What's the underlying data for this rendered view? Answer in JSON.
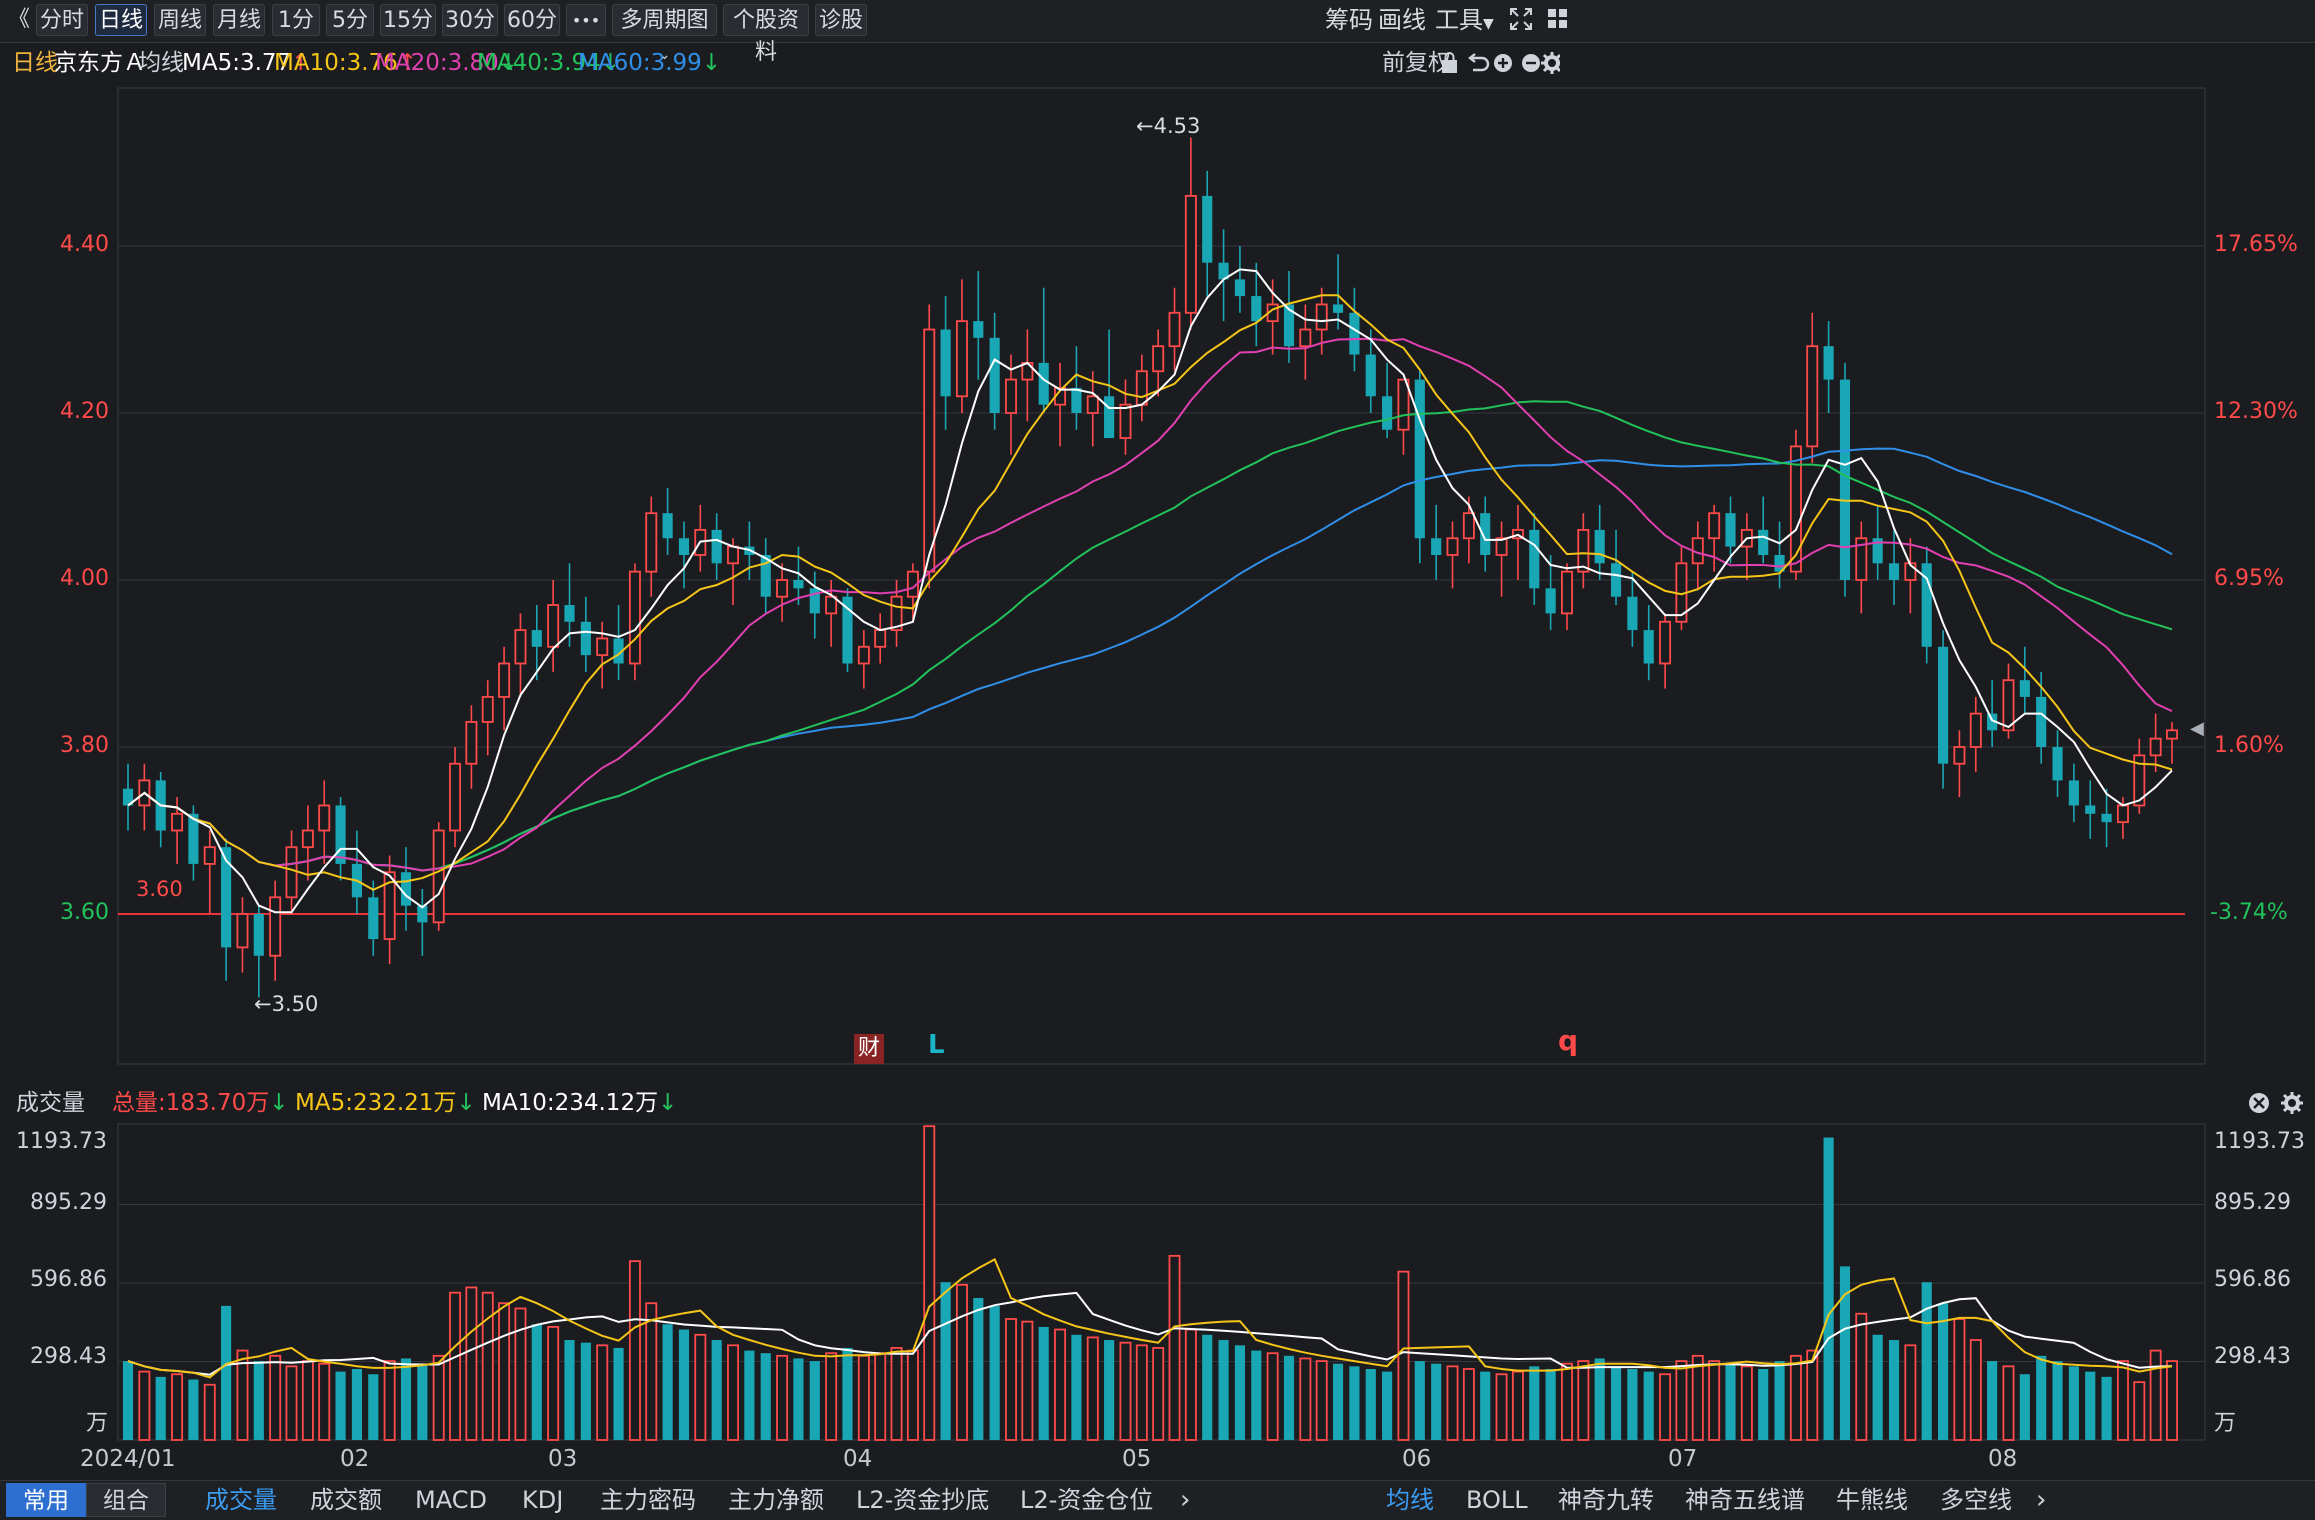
{
  "toolbar": {
    "back_glyph": "《",
    "periods": [
      "分时",
      "日线",
      "周线",
      "月线",
      "1分",
      "5分",
      "15分",
      "30分",
      "60分"
    ],
    "active_period": "日线",
    "more_glyph": "•••",
    "multi_period": "多周期图",
    "stock_info": "个股资料",
    "diagnose": "诊股",
    "chips": "筹码",
    "draw": "画线",
    "tools": "工具"
  },
  "info": {
    "period": "日线",
    "stock_name": "京东方Ａ",
    "ma_label": "均线",
    "ma5": "MA5:3.77",
    "ma10": "MA10:3.76",
    "ma20": "MA20:3.80",
    "ma40": "MA40:3.94",
    "ma60": "MA60:3.99",
    "adjust": "前复权"
  },
  "colors": {
    "up": "#ff4a4a",
    "down": "#1aa7b5",
    "ma5": "#ffffff",
    "ma10": "#f5c518",
    "ma20": "#e040b0",
    "ma40": "#22c25a",
    "ma60": "#2f8fe8",
    "ref_line": "#e8333a"
  },
  "price_axis": {
    "ticks": [
      "4.40",
      "4.20",
      "4.00",
      "3.80",
      "3.60"
    ],
    "pct_ticks": [
      "17.65%",
      "12.30%",
      "6.95%",
      "1.60%",
      "-3.74%"
    ]
  },
  "annotations": {
    "high": "←4.53",
    "low": "←3.50",
    "ref_label": "3.60",
    "fin_marker": "财",
    "marker_L": "L",
    "marker_q": "q"
  },
  "volume": {
    "title": "成交量",
    "total": "总量:183.70万",
    "ma5": "MA5:232.21万",
    "ma10": "MA10:234.12万",
    "ticks": [
      "1193.73",
      "895.29",
      "596.86",
      "298.43"
    ],
    "unit": "万"
  },
  "x_axis": [
    "2024/01",
    "02",
    "03",
    "04",
    "05",
    "06",
    "07",
    "08"
  ],
  "bottom_tabs_left": [
    "常用",
    "组合"
  ],
  "indicator_tabs": [
    "成交量",
    "成交额",
    "MACD",
    "KDJ",
    "主力密码",
    "主力净额",
    "L2-资金抄底",
    "L2-资金仓位"
  ],
  "overlay_tabs": [
    "均线",
    "BOLL",
    "神奇九转",
    "神奇五线谱",
    "牛熊线",
    "多空线"
  ],
  "chart_data": {
    "type": "candlestick",
    "price_range": [
      3.45,
      4.58
    ],
    "reference_price": 3.6,
    "high_price": 4.53,
    "low_price": 3.5,
    "volume_range": [
      0,
      1193.73
    ],
    "candles": [
      [
        3.75,
        3.78,
        3.7,
        3.73
      ],
      [
        3.73,
        3.78,
        3.7,
        3.76
      ],
      [
        3.76,
        3.77,
        3.68,
        3.7
      ],
      [
        3.7,
        3.74,
        3.66,
        3.72
      ],
      [
        3.72,
        3.73,
        3.64,
        3.66
      ],
      [
        3.66,
        3.7,
        3.6,
        3.68
      ],
      [
        3.68,
        3.69,
        3.52,
        3.56
      ],
      [
        3.56,
        3.62,
        3.53,
        3.6
      ],
      [
        3.6,
        3.61,
        3.5,
        3.55
      ],
      [
        3.55,
        3.64,
        3.52,
        3.62
      ],
      [
        3.62,
        3.7,
        3.6,
        3.68
      ],
      [
        3.68,
        3.73,
        3.64,
        3.7
      ],
      [
        3.7,
        3.76,
        3.66,
        3.73
      ],
      [
        3.73,
        3.74,
        3.64,
        3.66
      ],
      [
        3.66,
        3.7,
        3.6,
        3.62
      ],
      [
        3.62,
        3.64,
        3.55,
        3.57
      ],
      [
        3.57,
        3.67,
        3.54,
        3.65
      ],
      [
        3.65,
        3.68,
        3.58,
        3.61
      ],
      [
        3.61,
        3.63,
        3.55,
        3.59
      ],
      [
        3.59,
        3.71,
        3.58,
        3.7
      ],
      [
        3.7,
        3.8,
        3.68,
        3.78
      ],
      [
        3.78,
        3.85,
        3.75,
        3.83
      ],
      [
        3.83,
        3.88,
        3.79,
        3.86
      ],
      [
        3.86,
        3.92,
        3.82,
        3.9
      ],
      [
        3.9,
        3.96,
        3.86,
        3.94
      ],
      [
        3.94,
        3.97,
        3.88,
        3.92
      ],
      [
        3.92,
        4.0,
        3.89,
        3.97
      ],
      [
        3.97,
        4.02,
        3.92,
        3.95
      ],
      [
        3.95,
        3.98,
        3.89,
        3.91
      ],
      [
        3.91,
        3.95,
        3.87,
        3.93
      ],
      [
        3.93,
        3.97,
        3.88,
        3.9
      ],
      [
        3.9,
        4.02,
        3.88,
        4.01
      ],
      [
        4.01,
        4.1,
        3.98,
        4.08
      ],
      [
        4.08,
        4.11,
        4.03,
        4.05
      ],
      [
        4.05,
        4.07,
        3.99,
        4.03
      ],
      [
        4.03,
        4.09,
        4.01,
        4.06
      ],
      [
        4.06,
        4.08,
        4.0,
        4.02
      ],
      [
        4.02,
        4.05,
        3.97,
        4.04
      ],
      [
        4.04,
        4.07,
        4.0,
        4.03
      ],
      [
        4.03,
        4.05,
        3.96,
        3.98
      ],
      [
        3.98,
        4.02,
        3.95,
        4.0
      ],
      [
        4.0,
        4.04,
        3.97,
        3.99
      ],
      [
        3.99,
        4.01,
        3.93,
        3.96
      ],
      [
        3.96,
        4.0,
        3.92,
        3.98
      ],
      [
        3.98,
        3.99,
        3.89,
        3.9
      ],
      [
        3.9,
        3.94,
        3.87,
        3.92
      ],
      [
        3.92,
        3.96,
        3.9,
        3.94
      ],
      [
        3.94,
        4.0,
        3.92,
        3.98
      ],
      [
        3.98,
        4.02,
        3.95,
        4.01
      ],
      [
        4.01,
        4.33,
        3.99,
        4.3
      ],
      [
        4.3,
        4.34,
        4.18,
        4.22
      ],
      [
        4.22,
        4.36,
        4.2,
        4.31
      ],
      [
        4.31,
        4.37,
        4.24,
        4.29
      ],
      [
        4.29,
        4.32,
        4.18,
        4.2
      ],
      [
        4.2,
        4.27,
        4.15,
        4.24
      ],
      [
        4.24,
        4.3,
        4.19,
        4.26
      ],
      [
        4.26,
        4.35,
        4.2,
        4.21
      ],
      [
        4.21,
        4.26,
        4.16,
        4.23
      ],
      [
        4.23,
        4.28,
        4.18,
        4.2
      ],
      [
        4.2,
        4.25,
        4.16,
        4.22
      ],
      [
        4.22,
        4.3,
        4.18,
        4.17
      ],
      [
        4.17,
        4.24,
        4.15,
        4.21
      ],
      [
        4.21,
        4.27,
        4.19,
        4.25
      ],
      [
        4.25,
        4.3,
        4.22,
        4.28
      ],
      [
        4.28,
        4.35,
        4.25,
        4.32
      ],
      [
        4.32,
        4.53,
        4.3,
        4.46
      ],
      [
        4.46,
        4.49,
        4.34,
        4.38
      ],
      [
        4.38,
        4.42,
        4.31,
        4.36
      ],
      [
        4.36,
        4.4,
        4.32,
        4.34
      ],
      [
        4.34,
        4.38,
        4.28,
        4.31
      ],
      [
        4.31,
        4.36,
        4.27,
        4.33
      ],
      [
        4.33,
        4.37,
        4.26,
        4.28
      ],
      [
        4.28,
        4.33,
        4.24,
        4.3
      ],
      [
        4.3,
        4.35,
        4.27,
        4.33
      ],
      [
        4.33,
        4.39,
        4.3,
        4.32
      ],
      [
        4.32,
        4.35,
        4.25,
        4.27
      ],
      [
        4.27,
        4.3,
        4.2,
        4.22
      ],
      [
        4.22,
        4.26,
        4.17,
        4.18
      ],
      [
        4.18,
        4.24,
        4.15,
        4.24
      ],
      [
        4.24,
        4.25,
        4.02,
        4.05
      ],
      [
        4.05,
        4.09,
        4.0,
        4.03
      ],
      [
        4.03,
        4.07,
        3.99,
        4.05
      ],
      [
        4.05,
        4.1,
        4.02,
        4.08
      ],
      [
        4.08,
        4.1,
        4.01,
        4.03
      ],
      [
        4.03,
        4.07,
        3.98,
        4.05
      ],
      [
        4.05,
        4.09,
        4.0,
        4.06
      ],
      [
        4.06,
        4.08,
        3.97,
        3.99
      ],
      [
        3.99,
        4.03,
        3.94,
        3.96
      ],
      [
        3.96,
        4.02,
        3.94,
        4.01
      ],
      [
        4.01,
        4.08,
        3.99,
        4.06
      ],
      [
        4.06,
        4.09,
        4.0,
        4.02
      ],
      [
        4.02,
        4.06,
        3.97,
        3.98
      ],
      [
        3.98,
        4.01,
        3.92,
        3.94
      ],
      [
        3.94,
        3.97,
        3.88,
        3.9
      ],
      [
        3.9,
        3.96,
        3.87,
        3.95
      ],
      [
        3.95,
        4.04,
        3.94,
        4.02
      ],
      [
        4.02,
        4.07,
        3.99,
        4.05
      ],
      [
        4.05,
        4.09,
        4.01,
        4.08
      ],
      [
        4.08,
        4.1,
        4.02,
        4.04
      ],
      [
        4.04,
        4.08,
        4.0,
        4.06
      ],
      [
        4.06,
        4.1,
        4.02,
        4.03
      ],
      [
        4.03,
        4.07,
        3.99,
        4.01
      ],
      [
        4.01,
        4.18,
        4.0,
        4.16
      ],
      [
        4.16,
        4.32,
        4.14,
        4.28
      ],
      [
        4.28,
        4.31,
        4.2,
        4.24
      ],
      [
        4.24,
        4.26,
        3.98,
        4.0
      ],
      [
        4.0,
        4.07,
        3.96,
        4.05
      ],
      [
        4.05,
        4.09,
        4.0,
        4.02
      ],
      [
        4.02,
        4.06,
        3.97,
        4.0
      ],
      [
        4.0,
        4.05,
        3.96,
        4.02
      ],
      [
        4.02,
        4.04,
        3.9,
        3.92
      ],
      [
        3.92,
        3.94,
        3.75,
        3.78
      ],
      [
        3.78,
        3.82,
        3.74,
        3.8
      ],
      [
        3.8,
        3.86,
        3.77,
        3.84
      ],
      [
        3.84,
        3.88,
        3.8,
        3.82
      ],
      [
        3.82,
        3.9,
        3.81,
        3.88
      ],
      [
        3.88,
        3.92,
        3.84,
        3.86
      ],
      [
        3.86,
        3.89,
        3.78,
        3.8
      ],
      [
        3.8,
        3.82,
        3.74,
        3.76
      ],
      [
        3.76,
        3.78,
        3.71,
        3.73
      ],
      [
        3.73,
        3.76,
        3.69,
        3.72
      ],
      [
        3.72,
        3.75,
        3.68,
        3.71
      ],
      [
        3.71,
        3.74,
        3.69,
        3.73
      ],
      [
        3.73,
        3.81,
        3.72,
        3.79
      ],
      [
        3.79,
        3.84,
        3.77,
        3.81
      ],
      [
        3.81,
        3.83,
        3.78,
        3.82
      ]
    ],
    "volumes": [
      300,
      260,
      240,
      250,
      230,
      210,
      510,
      340,
      300,
      320,
      280,
      300,
      290,
      260,
      270,
      250,
      300,
      310,
      290,
      320,
      560,
      580,
      560,
      520,
      500,
      440,
      430,
      380,
      370,
      360,
      350,
      680,
      520,
      440,
      420,
      400,
      380,
      360,
      340,
      330,
      320,
      310,
      300,
      330,
      350,
      320,
      330,
      350,
      340,
      1193,
      600,
      590,
      540,
      510,
      460,
      450,
      430,
      420,
      400,
      390,
      380,
      370,
      360,
      350,
      700,
      420,
      400,
      380,
      360,
      340,
      330,
      320,
      310,
      300,
      290,
      280,
      270,
      260,
      640,
      300,
      290,
      280,
      270,
      260,
      250,
      260,
      280,
      270,
      290,
      300,
      310,
      280,
      270,
      260,
      250,
      300,
      320,
      300,
      290,
      280,
      270,
      300,
      320,
      340,
      1150,
      660,
      480,
      400,
      380,
      360,
      600,
      520,
      460,
      380,
      300,
      280,
      250,
      320,
      300,
      280,
      260,
      240,
      300,
      220,
      340,
      300
    ]
  }
}
